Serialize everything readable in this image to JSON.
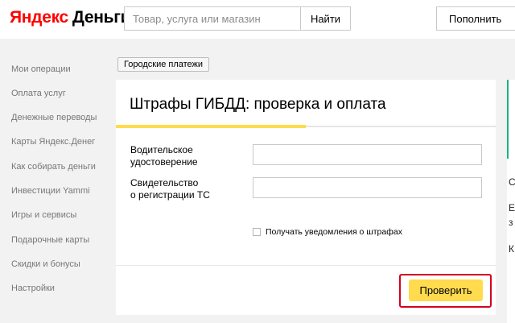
{
  "header": {
    "logo_part1": "Яндекс",
    "logo_part2": "Деньги",
    "search_placeholder": "Товар, услуга или магазин",
    "search_button": "Найти",
    "topup_button": "Пополнить"
  },
  "sidebar": {
    "items": [
      {
        "label": "Мои операции"
      },
      {
        "label": "Оплата услуг"
      },
      {
        "label": "Денежные переводы"
      },
      {
        "label": "Карты Яндекс.Денег"
      },
      {
        "label": "Как собирать деньги"
      },
      {
        "label": "Инвестиции Yammi"
      },
      {
        "label": "Игры и сервисы"
      },
      {
        "label": "Подарочные карты"
      },
      {
        "label": "Скидки и бонусы"
      },
      {
        "label": "Настройки"
      }
    ]
  },
  "breadcrumb": "Городские платежи",
  "form": {
    "title": "Штрафы ГИБДД: проверка и оплата",
    "progress_fraction": 0.5,
    "license_label_line1": "Водительское",
    "license_label_line2": "удостоверение",
    "license_value": "",
    "registration_label_line1": "Свидетельство",
    "registration_label_line2": "о регистрации ТС",
    "registration_value": "",
    "notify_label": "Получать уведомления о штрафах",
    "notify_checked": false,
    "submit_button": "Проверить"
  },
  "right_panel": {
    "chars": [
      "С",
      "Е",
      "з",
      "К"
    ]
  },
  "colors": {
    "logo_red": "#ff0000",
    "accent_yellow": "#ffdb4d",
    "highlight_red": "#d4001f",
    "accent_green": "#19b47a",
    "sidebar_text": "#777777"
  }
}
